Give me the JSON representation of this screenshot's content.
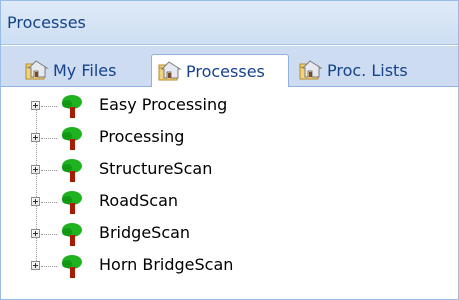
{
  "panel": {
    "title": "Processes"
  },
  "tabs": [
    {
      "label": "My Files",
      "active": false
    },
    {
      "label": "Processes",
      "active": true
    },
    {
      "label": "Proc. Lists",
      "active": false
    }
  ],
  "tree": {
    "items": [
      {
        "label": "Easy Processing"
      },
      {
        "label": "Processing"
      },
      {
        "label": "StructureScan"
      },
      {
        "label": "RoadScan"
      },
      {
        "label": "BridgeScan"
      },
      {
        "label": "Horn BridgeScan"
      }
    ]
  },
  "colors": {
    "title_text": "#15428b",
    "border": "#99bbe8",
    "tree_green": "#1fb21f",
    "tree_trunk": "#a61c00"
  },
  "icons": {
    "tab_icon": "folder-house-icon",
    "tree_icon": "green-tree-icon"
  }
}
